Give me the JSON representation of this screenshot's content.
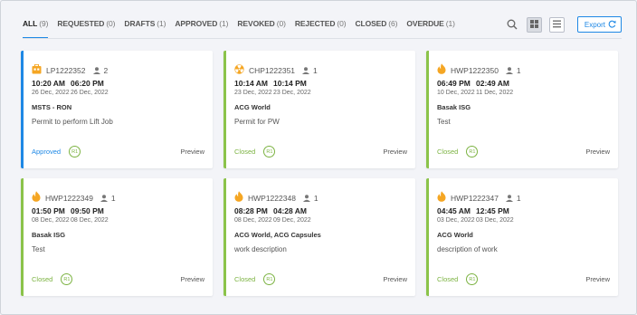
{
  "tabs": [
    {
      "label": "ALL",
      "count": "(9)"
    },
    {
      "label": "REQUESTED",
      "count": "(0)"
    },
    {
      "label": "DRAFTS",
      "count": "(1)"
    },
    {
      "label": "APPROVED",
      "count": "(1)"
    },
    {
      "label": "REVOKED",
      "count": "(0)"
    },
    {
      "label": "REJECTED",
      "count": "(0)"
    },
    {
      "label": "CLOSED",
      "count": "(6)"
    },
    {
      "label": "OVERDUE",
      "count": "(1)"
    }
  ],
  "toolbar": {
    "export_label": "Export",
    "search_icon": "search-icon",
    "grid_icon": "grid-view-icon",
    "list_icon": "list-view-icon",
    "refresh_icon": "refresh-icon"
  },
  "colors": {
    "accent": "#1e88e5",
    "closed": "#8bc34a",
    "permit_icon": "#f5a623"
  },
  "cards": [
    {
      "id": "LP1222352",
      "icon": "lift-permit-icon",
      "users": "2",
      "time_start": "10:20 AM",
      "time_end": "06:20 PM",
      "date_start": "26 Dec, 2022",
      "date_end": "26 Dec, 2022",
      "org": "MSTS - RON",
      "desc": "Permit to perform Lift Job",
      "status": "Approved",
      "badge": "R1",
      "preview": "Preview"
    },
    {
      "id": "CHP1222351",
      "icon": "radiation-icon",
      "users": "1",
      "time_start": "10:14 AM",
      "time_end": "10:14 PM",
      "date_start": "23 Dec, 2022",
      "date_end": "23 Dec, 2022",
      "org": "ACG World",
      "desc": "Permit for PW",
      "status": "Closed",
      "badge": "R1",
      "preview": "Preview"
    },
    {
      "id": "HWP1222350",
      "icon": "flame-icon",
      "users": "1",
      "time_start": "06:49 PM",
      "time_end": "02:49 AM",
      "date_start": "10 Dec, 2022",
      "date_end": "11 Dec, 2022",
      "org": "Basak ISG",
      "desc": "Test",
      "status": "Closed",
      "badge": "R1",
      "preview": "Preview"
    },
    {
      "id": "HWP1222349",
      "icon": "flame-icon",
      "users": "1",
      "time_start": "01:50 PM",
      "time_end": "09:50 PM",
      "date_start": "08 Dec, 2022",
      "date_end": "08 Dec, 2022",
      "org": "Basak ISG",
      "desc": "Test",
      "status": "Closed",
      "badge": "R1",
      "preview": "Preview"
    },
    {
      "id": "HWP1222348",
      "icon": "flame-icon",
      "users": "1",
      "time_start": "08:28 PM",
      "time_end": "04:28 AM",
      "date_start": "08 Dec, 2022",
      "date_end": "09 Dec, 2022",
      "org": "ACG World, ACG Capsules",
      "desc": "work description",
      "status": "Closed",
      "badge": "R1",
      "preview": "Preview"
    },
    {
      "id": "HWP1222347",
      "icon": "flame-icon",
      "users": "1",
      "time_start": "04:45 AM",
      "time_end": "12:45 PM",
      "date_start": "03 Dec, 2022",
      "date_end": "03 Dec, 2022",
      "org": "ACG World",
      "desc": "description of work",
      "status": "Closed",
      "badge": "R1",
      "preview": "Preview"
    }
  ]
}
